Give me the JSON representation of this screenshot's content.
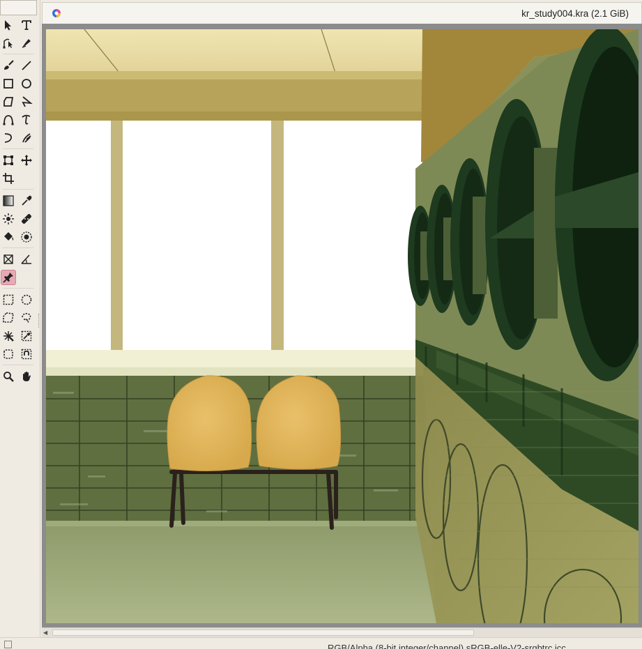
{
  "document": {
    "title": "kr_study004.kra (2.1 GiB)"
  },
  "status_bar": {
    "text": "RGB/Alpha (8-bit integer/channel)   sRGB-elle-V2-srgbtrc.icc"
  },
  "toolbox": {
    "active_tool": "assistant-tool",
    "tools": [
      "select-shapes-icon",
      "text-icon",
      "edit-shapes-icon",
      "calligraphy-icon",
      "freehand-brush-icon",
      "line-icon",
      "rectangle-icon",
      "ellipse-icon",
      "polygon-icon",
      "polyline-icon",
      "bezier-curve-icon",
      "freehand-path-icon",
      "dynamic-brush-icon",
      "multibrush-icon",
      "transform-icon",
      "move-icon",
      "crop-icon",
      "gradient-icon",
      "color-picker-icon",
      "colorize-mask-icon",
      "smart-patch-icon",
      "fill-icon",
      "enclose-fill-icon",
      "assistant-icon",
      "measure-icon",
      "reference-images-icon",
      "rect-select-icon",
      "ellipse-select-icon",
      "polygon-select-icon",
      "freehand-select-icon",
      "contiguous-select-icon",
      "similar-select-icon",
      "bezier-select-icon",
      "magnetic-select-icon",
      "zoom-icon",
      "pan-icon"
    ]
  },
  "colors": {
    "accent_active": "#e7a9b3",
    "wall_green": "#5d6e3e",
    "chair_yellow": "#e0b45a",
    "ceiling": "#ece0a7"
  }
}
